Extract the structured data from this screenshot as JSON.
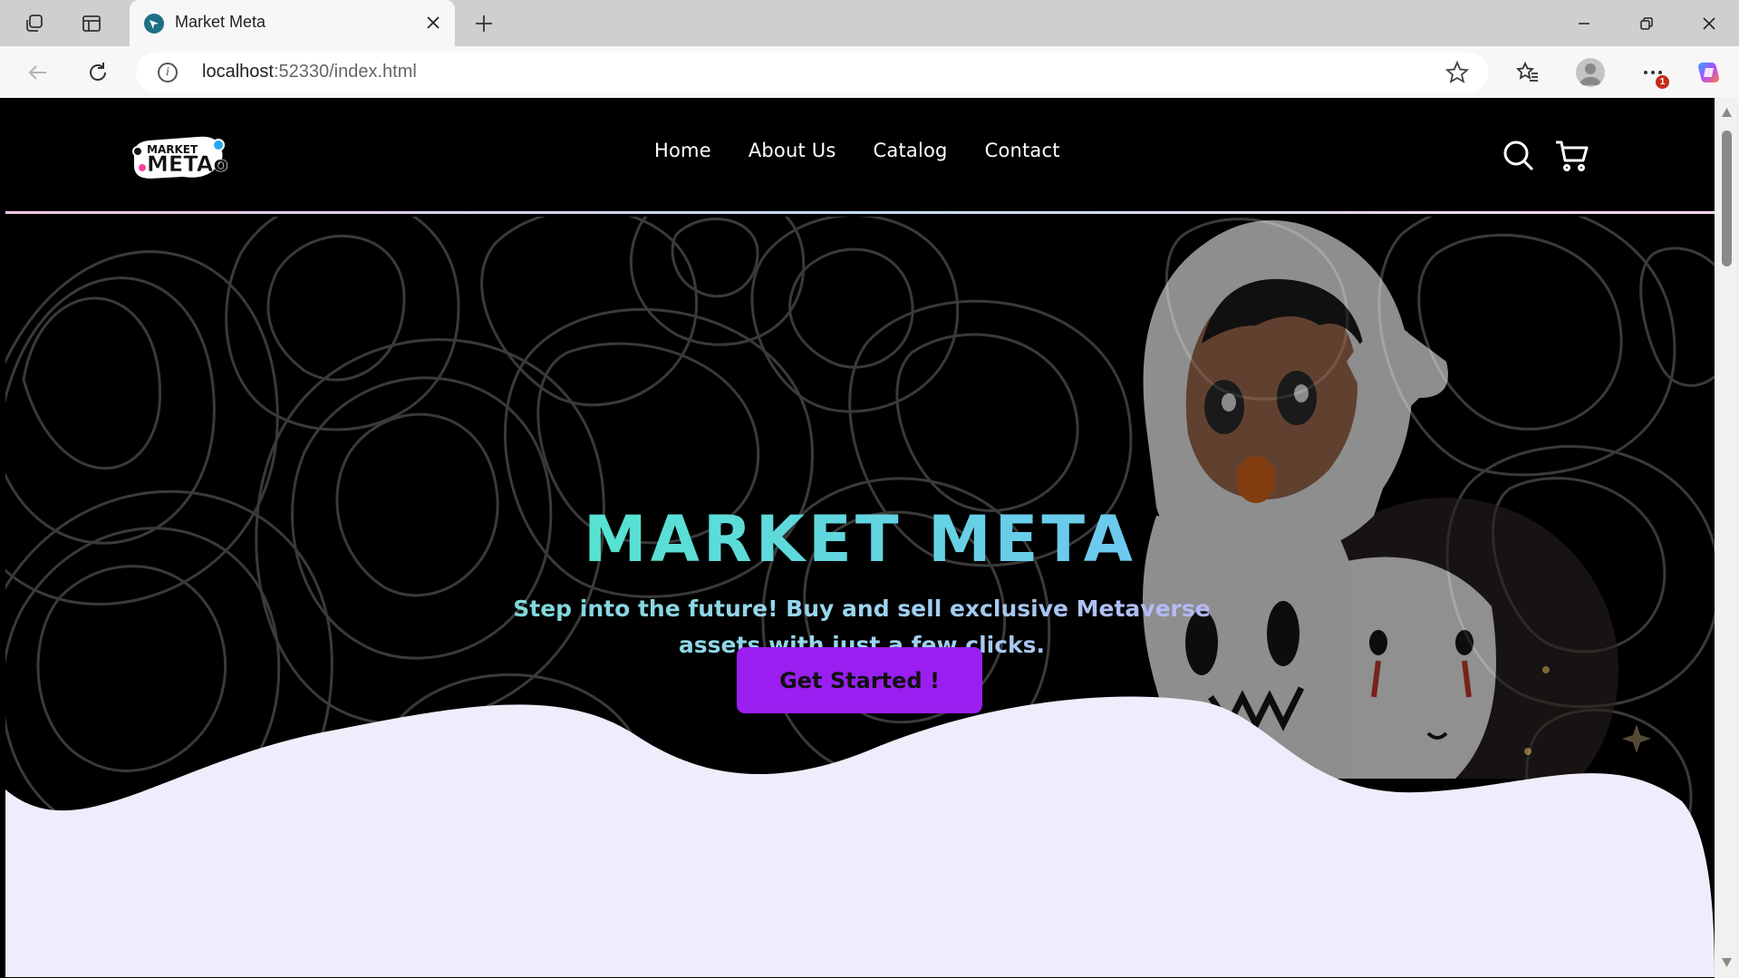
{
  "browser": {
    "tab_title": "Market Meta",
    "url_host": "localhost",
    "url_rest": ":52330/index.html",
    "notification_count": "1"
  },
  "site": {
    "nav": [
      "Home",
      "About Us",
      "Catalog",
      "Contact"
    ],
    "logo_text_top": "MARKET",
    "logo_text_main": "METAo",
    "hero_title": "MARKET META",
    "hero_subtitle": "Step into the future! Buy and sell exclusive Metaverse assets with just a few clicks.",
    "cta_label": "Get Started !"
  },
  "colors": {
    "accent_purple": "#9a1ff0",
    "title_gradient_start": "#5fd3c8",
    "title_gradient_end": "#a8a8f8",
    "wave_fill": "#efedfb"
  },
  "icons": {
    "search": "search-icon",
    "cart": "cart-icon"
  }
}
